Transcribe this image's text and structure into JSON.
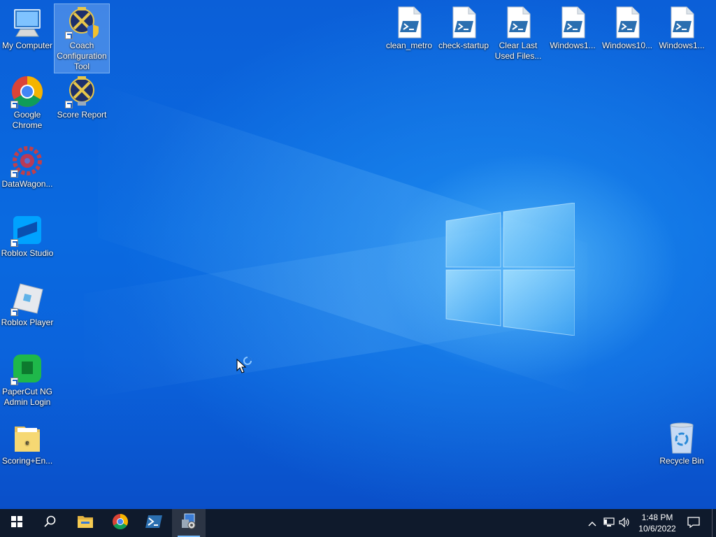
{
  "desktop": {
    "left_icons": [
      {
        "label": "My Computer"
      },
      {
        "label": "Coach Configuration Tool"
      },
      {
        "label": "Google Chrome"
      },
      {
        "label": "Score Report"
      },
      {
        "label": "DataWagon..."
      },
      {
        "label": "Roblox Studio"
      },
      {
        "label": "Roblox Player"
      },
      {
        "label": "PaperCut NG Admin Login"
      },
      {
        "label": "Scoring+En..."
      }
    ],
    "top_icons": [
      {
        "label": "clean_metro"
      },
      {
        "label": "check-startup"
      },
      {
        "label": "Clear Last Used Files..."
      },
      {
        "label": "Windows1..."
      },
      {
        "label": "Windows10..."
      },
      {
        "label": "Windows1..."
      }
    ],
    "recycle_bin": {
      "label": "Recycle Bin"
    }
  },
  "taskbar": {
    "items": [
      {
        "name": "start",
        "icon": "windows-logo-icon"
      },
      {
        "name": "search",
        "icon": "search-icon"
      },
      {
        "name": "file-explorer",
        "icon": "folder-icon"
      },
      {
        "name": "chrome",
        "icon": "chrome-icon"
      },
      {
        "name": "powershell",
        "icon": "powershell-icon"
      },
      {
        "name": "configuration-tool",
        "icon": "config-tool-icon"
      }
    ],
    "clock": {
      "time": "1:48 PM",
      "date": "10/6/2022"
    }
  },
  "colors": {
    "taskbar_bg": "#0f1a2c",
    "desktop_blue": "#0a5ad6",
    "accent": "#7cc0ff"
  }
}
